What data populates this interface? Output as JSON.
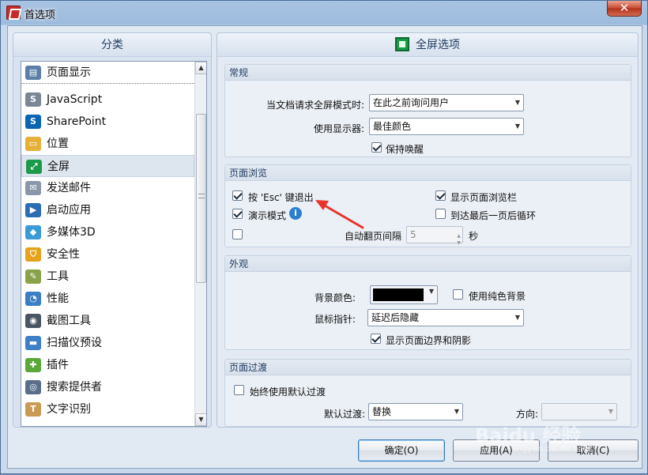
{
  "window": {
    "title": "首选项",
    "close_glyph": "✕"
  },
  "categories": {
    "header": "分类",
    "items": [
      {
        "label": "页面显示",
        "icon": "page-display-icon",
        "color": "#5b7fa8",
        "glyph": "▤"
      },
      {
        "label": "JavaScript",
        "icon": "javascript-icon",
        "color": "#7b8696",
        "glyph": "S"
      },
      {
        "label": "SharePoint",
        "icon": "sharepoint-icon",
        "color": "#0a64b4",
        "glyph": "S"
      },
      {
        "label": "位置",
        "icon": "folder-icon",
        "color": "#e6b13a",
        "glyph": "▭"
      },
      {
        "label": "全屏",
        "icon": "fullscreen-icon",
        "color": "#1a9a4a",
        "glyph": "⤢"
      },
      {
        "label": "发送邮件",
        "icon": "mail-icon",
        "color": "#8a97a8",
        "glyph": "✉"
      },
      {
        "label": "启动应用",
        "icon": "launch-app-icon",
        "color": "#2b6db3",
        "glyph": "▶"
      },
      {
        "label": "多媒体3D",
        "icon": "multimedia-3d-icon",
        "color": "#3a9ad6",
        "glyph": "◆"
      },
      {
        "label": "安全性",
        "icon": "security-shield-icon",
        "color": "#e8a31c",
        "glyph": "⛉"
      },
      {
        "label": "工具",
        "icon": "tools-icon",
        "color": "#8aa24a",
        "glyph": "✎"
      },
      {
        "label": "性能",
        "icon": "performance-gauge-icon",
        "color": "#3b7ec4",
        "glyph": "◔"
      },
      {
        "label": "截图工具",
        "icon": "camera-icon",
        "color": "#4a5563",
        "glyph": "◉"
      },
      {
        "label": "扫描仪预设",
        "icon": "scanner-icon",
        "color": "#3e7fc8",
        "glyph": "▬"
      },
      {
        "label": "插件",
        "icon": "plugin-icon",
        "color": "#5aa83a",
        "glyph": "✚"
      },
      {
        "label": "搜索提供者",
        "icon": "binoculars-icon",
        "color": "#5a6e8c",
        "glyph": "◎"
      },
      {
        "label": "文字识别",
        "icon": "ocr-text-icon",
        "color": "#c89a54",
        "glyph": "T"
      }
    ],
    "selected_index": 4
  },
  "right": {
    "header": "全屏选项",
    "general": {
      "title": "常规",
      "request_label": "当文档请求全屏模式时:",
      "request_value": "在此之前询问用户",
      "monitor_label": "使用显示器:",
      "monitor_value": "最佳颜色",
      "keep_awake_label": "保持唤醒",
      "keep_awake_checked": true
    },
    "browse": {
      "title": "页面浏览",
      "esc_label": "按 'Esc' 键退出",
      "esc_checked": true,
      "show_navbar_label": "显示页面浏览栏",
      "show_navbar_checked": true,
      "presentation_label": "演示模式",
      "presentation_checked": true,
      "loop_label": "到达最后一页后循环",
      "loop_checked": false,
      "auto_flip_checked": false,
      "auto_flip_label": "自动翻页间隔",
      "auto_flip_value": "5",
      "auto_flip_unit": "秒"
    },
    "appearance": {
      "title": "外观",
      "bg_color_label": "背景颜色:",
      "bg_color": "#000000",
      "solid_bg_label": "使用纯色背景",
      "solid_bg_checked": false,
      "cursor_label": "鼠标指针:",
      "cursor_value": "延迟后隐藏",
      "show_border_label": "显示页面边界和阴影",
      "show_border_checked": true
    },
    "transition": {
      "title": "页面过渡",
      "always_default_label": "始终使用默认过渡",
      "always_default_checked": false,
      "default_label": "默认过渡:",
      "default_value": "替换",
      "direction_label": "方向:",
      "direction_value": ""
    }
  },
  "buttons": {
    "ok": "确定(O)",
    "apply": "应用(A)",
    "cancel": "取消(C)"
  },
  "watermark": {
    "main": "Baidu 经验",
    "sub": "jingyan.baidu.com"
  },
  "annotation_color": "#e8342a"
}
